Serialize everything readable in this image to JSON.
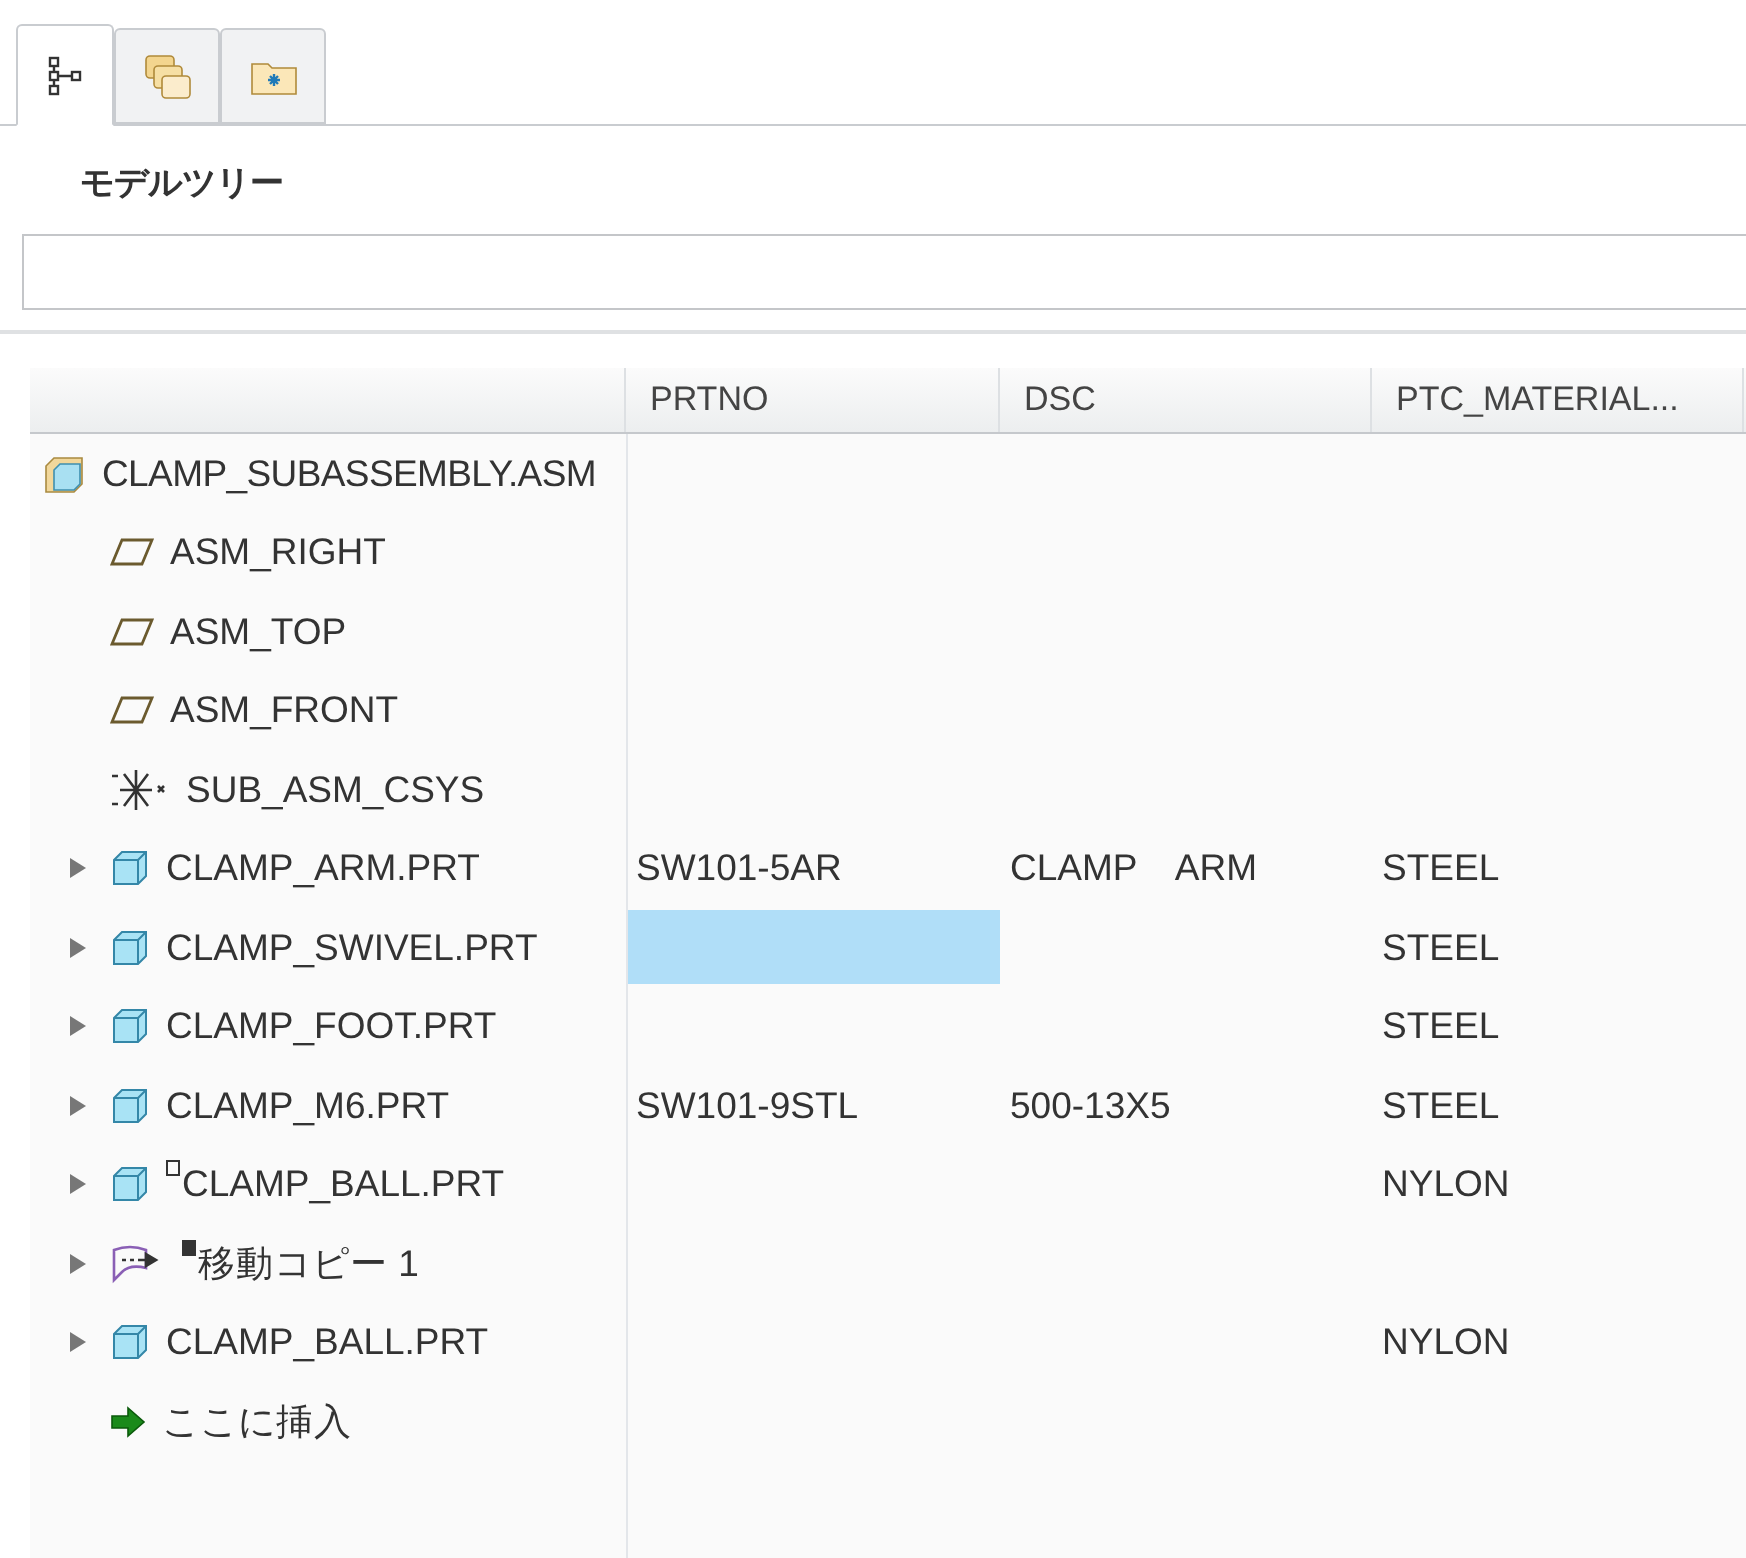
{
  "tabs": [
    {
      "kind": "tree",
      "selected": true
    },
    {
      "kind": "layers",
      "selected": false
    },
    {
      "kind": "folder",
      "selected": false
    }
  ],
  "panel_title": "モデルツリー",
  "table": {
    "columns": [
      "PRTNO",
      "DSC",
      "PTC_MATERIAL..."
    ],
    "tree": [
      {
        "kind": "assembly",
        "label": "CLAMP_SUBASSEMBLY.ASM",
        "children": [
          {
            "kind": "plane",
            "label": "ASM_RIGHT"
          },
          {
            "kind": "plane",
            "label": "ASM_TOP"
          },
          {
            "kind": "plane",
            "label": "ASM_FRONT"
          },
          {
            "kind": "csys",
            "label": "SUB_ASM_CSYS"
          },
          {
            "kind": "part",
            "label": "CLAMP_ARM.PRT",
            "expanded": false,
            "cells": [
              {
                "text": "SW101-5AR",
                "selected": false
              },
              {
                "text": "CLAMP　ARM",
                "selected": false
              },
              {
                "text": "STEEL",
                "selected": false
              }
            ]
          },
          {
            "kind": "part",
            "label": "CLAMP_SWIVEL.PRT",
            "expanded": false,
            "cells": [
              {
                "selected": true
              },
              {
                "selected": false
              },
              {
                "text": "STEEL",
                "selected": false
              }
            ]
          },
          {
            "kind": "part",
            "label": "CLAMP_FOOT.PRT",
            "expanded": false,
            "cells": [
              {
                "selected": false
              },
              {
                "selected": false
              },
              {
                "text": "STEEL",
                "selected": false
              }
            ]
          },
          {
            "kind": "part",
            "label": "CLAMP_M6.PRT",
            "expanded": false,
            "cells": [
              {
                "text": "SW101-9STL",
                "selected": false
              },
              {
                "text": "500-13X5",
                "selected": false
              },
              {
                "text": "STEEL",
                "selected": false
              }
            ]
          },
          {
            "kind": "part",
            "label": "CLAMP_BALL.PRT",
            "marker": {
              "filled": false
            },
            "expanded": false,
            "cells": [
              {
                "selected": false
              },
              {
                "selected": false
              },
              {
                "text": "NYLON",
                "selected": false
              }
            ]
          },
          {
            "kind": "move_copy",
            "label": "移動コピー 1",
            "marker": {
              "filled": true
            },
            "expanded": false
          },
          {
            "kind": "part",
            "label": "CLAMP_BALL.PRT",
            "expanded": false,
            "cells": [
              {
                "selected": false
              },
              {
                "selected": false
              },
              {
                "text": "NYLON",
                "selected": false
              }
            ]
          },
          {
            "kind": "insert",
            "label": "ここに挿入"
          }
        ]
      }
    ]
  }
}
